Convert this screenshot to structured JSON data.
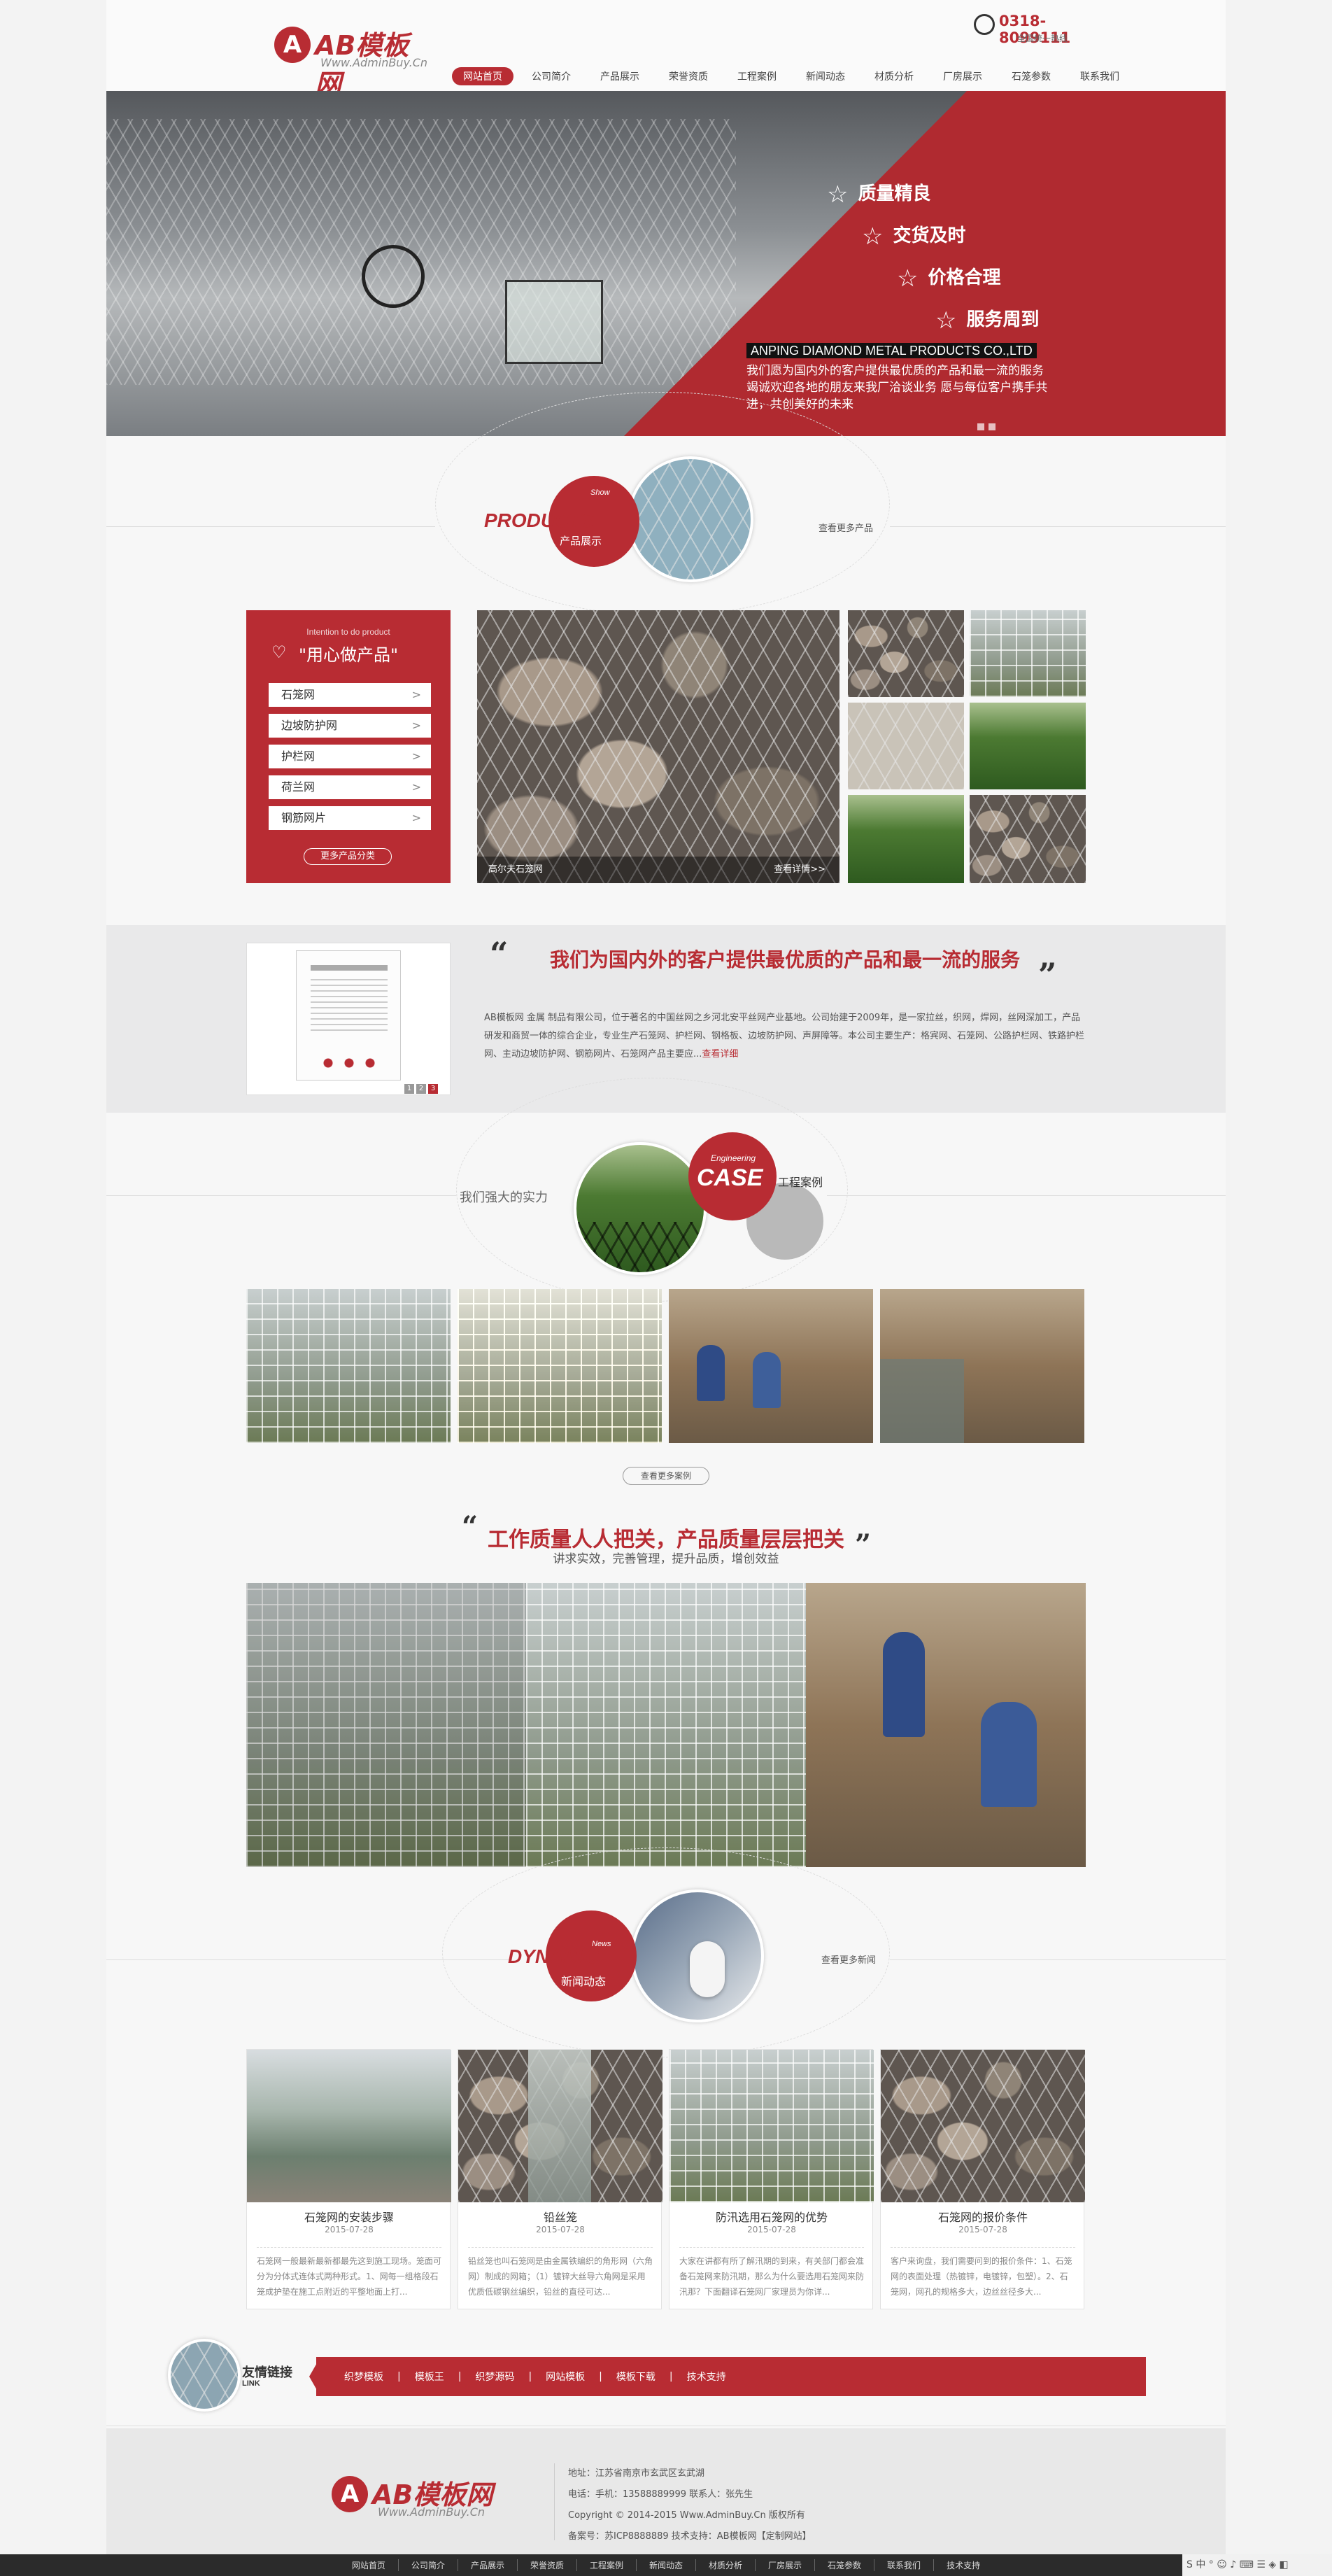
{
  "header": {
    "logo_mark": "A",
    "logo_text": "AB模板网",
    "logo_sub": "Www.AdminBuy.Cn",
    "phone": "0318-8099111",
    "phone_sub": "全国统一热线"
  },
  "nav": [
    "网站首页",
    "公司简介",
    "产品展示",
    "荣誉资质",
    "工程案例",
    "新闻动态",
    "材质分析",
    "厂房展示",
    "石笼参数",
    "联系我们"
  ],
  "banner": {
    "features": [
      "质量精良",
      "交货及时",
      "价格合理",
      "服务周到"
    ],
    "company": "ANPING DIAMOND METAL PRODUCTS CO.,LTD",
    "desc": "我们愿为国内外的客户提供最优质的产品和最一流的服务 竭诚欢迎各地的朋友来我厂洽谈业务 愿与每位客户携手共进，共创美好的未来",
    "star": "☆"
  },
  "products": {
    "title_en": "PRODUCTS",
    "title_cn": "产品展示",
    "tag": "Show",
    "more": "查看更多产品",
    "side_sub": "Intention to do product",
    "side_title": "\"用心做产品\"",
    "side_items": [
      "石笼网",
      "边坡防护网",
      "护栏网",
      "荷兰网",
      "钢筋网片"
    ],
    "side_arrow": ">",
    "side_more": "更多产品分类",
    "main_caption": "高尔夫石笼网",
    "main_more": "查看详情>>"
  },
  "about": {
    "title": "我们为国内外的客户提供最优质的产品和最一流的服务",
    "open_quote": "“",
    "close_quote": "”",
    "text": "AB模板网 金属 制品有限公司，位于著名的中国丝网之乡河北安平丝网产业基地。公司始建于2009年，是一家拉丝，织网，焊网，丝网深加工，产品研发和商贸一体的综合企业，专业生产石笼网、护栏网、钢格板、边坡防护网、声屏障等。本公司主要生产：格宾网、石笼网、公路护栏网、铁路护栏网、主动边坡防护网、钢筋网片、石笼网产品主要应...",
    "more": "查看详细",
    "pages": [
      "1",
      "2",
      "3"
    ]
  },
  "case": {
    "left_text": "我们强大的实力",
    "tag": "Engineering",
    "title_en": "CASE",
    "title_cn": "工程案例",
    "more": "查看更多案例"
  },
  "quality": {
    "title": "工作质量人人把关，产品质量层层把关",
    "sub": "讲求实效，完善管理，提升品质，增创效益"
  },
  "news": {
    "tag": "News",
    "title_en": "DYNAMIC",
    "title_cn": "新闻动态",
    "more": "查看更多新闻",
    "items": [
      {
        "title": "石笼网的安装步骤",
        "date": "2015-07-28",
        "desc": "石笼网一般最新最新都最先这到施工现场。笼面可分为分体式连体式两种形式。1、网每一组格段石笼成护垫在施工点附近的平整地面上打..."
      },
      {
        "title": "铅丝笼",
        "date": "2015-07-28",
        "desc": "铅丝笼也叫石笼网是由金属铁编织的角形网（六角网）制成的网箱；（1）镀锌大丝导六角网是采用优质低碳钢丝编织，铅丝的直径可达..."
      },
      {
        "title": "防汛选用石笼网的优势",
        "date": "2015-07-28",
        "desc": "大家在讲都有所了解汛期的到来，有关部门都会准备石笼网来防汛期，那么为什么要选用石笼网来防汛那？下面翻译石笼网厂家理员为你详..."
      },
      {
        "title": "石笼网的报价条件",
        "date": "2015-07-28",
        "desc": "客户来询盘，我们需要问到的报价条件：1、石笼网的表面处理（热镀锌，电镀锌，包塑）。2、石笼网，网孔的规格多大，边丝丝径多大..."
      }
    ]
  },
  "links": {
    "title_cn": "友情链接",
    "title_en": "LINK",
    "items": [
      "织梦模板",
      "模板王",
      "织梦源码",
      "网站模板",
      "模板下载",
      "技术支持"
    ]
  },
  "footer": {
    "address": "地址：江苏省南京市玄武区玄武湖",
    "contact": "电话：手机：13588889999 联系人：张先生",
    "copyright": "Copyright © 2014-2015 Www.AdminBuy.Cn 版权所有",
    "icp": "备案号：苏ICP8888889  技术支持：AB模板网【定制网站】"
  },
  "bottom_nav": [
    "网站首页",
    "公司简介",
    "产品展示",
    "荣誉资质",
    "工程案例",
    "新闻动态",
    "材质分析",
    "厂房展示",
    "石笼参数",
    "联系我们",
    "技术支持"
  ],
  "taskbar": {
    "text": "S 中 ° ☺ ♪ ⌨ ☰ ◈ ◧"
  },
  "colors": {
    "accent": "#b82c33"
  }
}
